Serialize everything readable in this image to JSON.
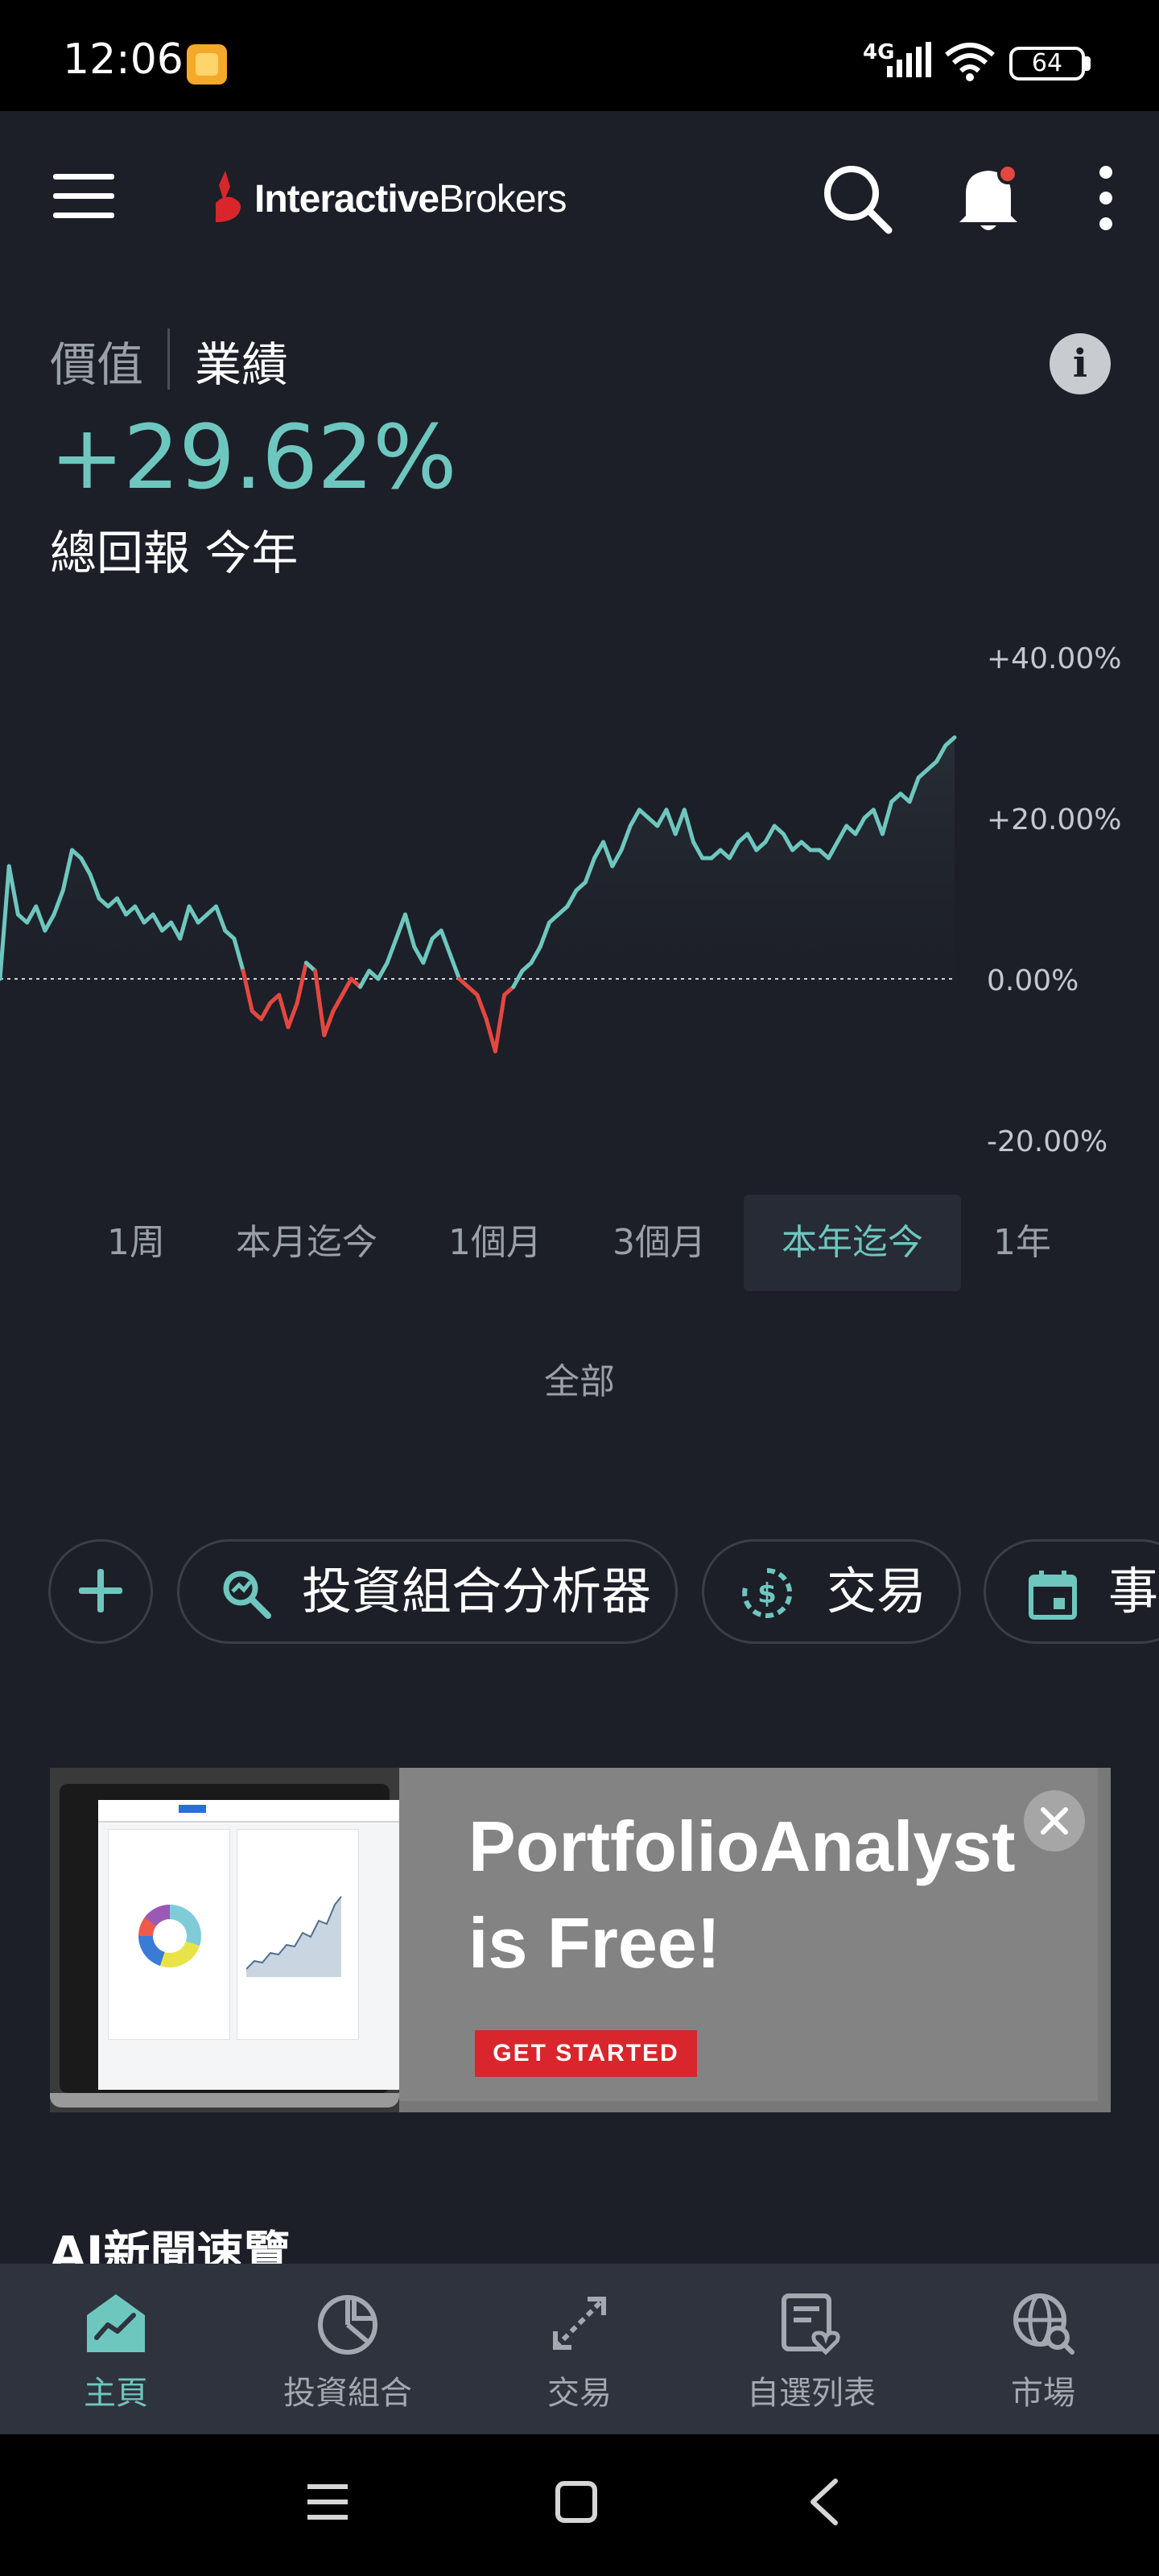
{
  "status_bar": {
    "time": "12:06",
    "network": "4G",
    "battery": "64"
  },
  "header": {
    "brand_bold": "Interactive",
    "brand_regular": "Brokers",
    "icons": [
      "menu-icon",
      "search-icon",
      "bell-icon",
      "more-icon"
    ]
  },
  "summary": {
    "tab_value": "價值",
    "tab_performance": "業績",
    "info": "i",
    "return_value": "+29.62%",
    "return_caption": "總回報 今年"
  },
  "chart_data": {
    "type": "line",
    "yticks": [
      "+40.00%",
      "+20.00%",
      "0.00%",
      "-20.00%"
    ],
    "ylim": [
      -20,
      40
    ],
    "baseline": 0,
    "colors": {
      "positive": "#6ec7bf",
      "negative": "#e4473f",
      "baseline": "#cfd2d6"
    },
    "values": [
      0,
      14,
      8,
      7,
      9,
      6,
      8,
      11,
      16,
      15,
      13,
      10,
      9,
      10,
      8,
      9,
      7,
      8,
      6,
      7,
      5,
      9,
      7,
      8,
      9,
      6,
      5,
      1,
      -4,
      -5,
      -3,
      -2,
      -6,
      -3,
      2,
      1,
      -7,
      -4,
      -2,
      0,
      -1,
      1,
      0,
      2,
      5,
      8,
      4,
      2,
      5,
      6,
      3,
      0,
      -1,
      -2,
      -5,
      -9,
      -2,
      -1,
      1,
      2,
      4,
      7,
      8,
      9,
      11,
      12,
      15,
      17,
      14,
      16,
      19,
      21,
      20,
      19,
      21,
      18,
      21,
      17,
      15,
      15,
      16,
      15,
      17,
      18,
      16,
      17,
      19,
      18,
      16,
      17,
      16,
      16,
      15,
      17,
      19,
      18,
      20,
      21,
      18,
      22,
      23,
      22,
      25,
      26,
      27,
      29,
      30
    ]
  },
  "periods": {
    "items": [
      "1周",
      "本月迄今",
      "1個月",
      "3個月",
      "本年迄今",
      "1年"
    ],
    "selected": "本年迄今",
    "all": "全部"
  },
  "actions": {
    "add": "+",
    "analyzer": "投資組合分析器",
    "trade": "交易",
    "events": "事"
  },
  "promo": {
    "title_line1": "PortfolioAnalyst",
    "title_line2": "is Free!",
    "cta": "GET STARTED"
  },
  "news": {
    "title": "AI新聞速覽"
  },
  "bottom_nav": {
    "home": "主頁",
    "portfolio": "投資組合",
    "trade": "交易",
    "watchlist": "自選列表",
    "markets": "市場"
  }
}
